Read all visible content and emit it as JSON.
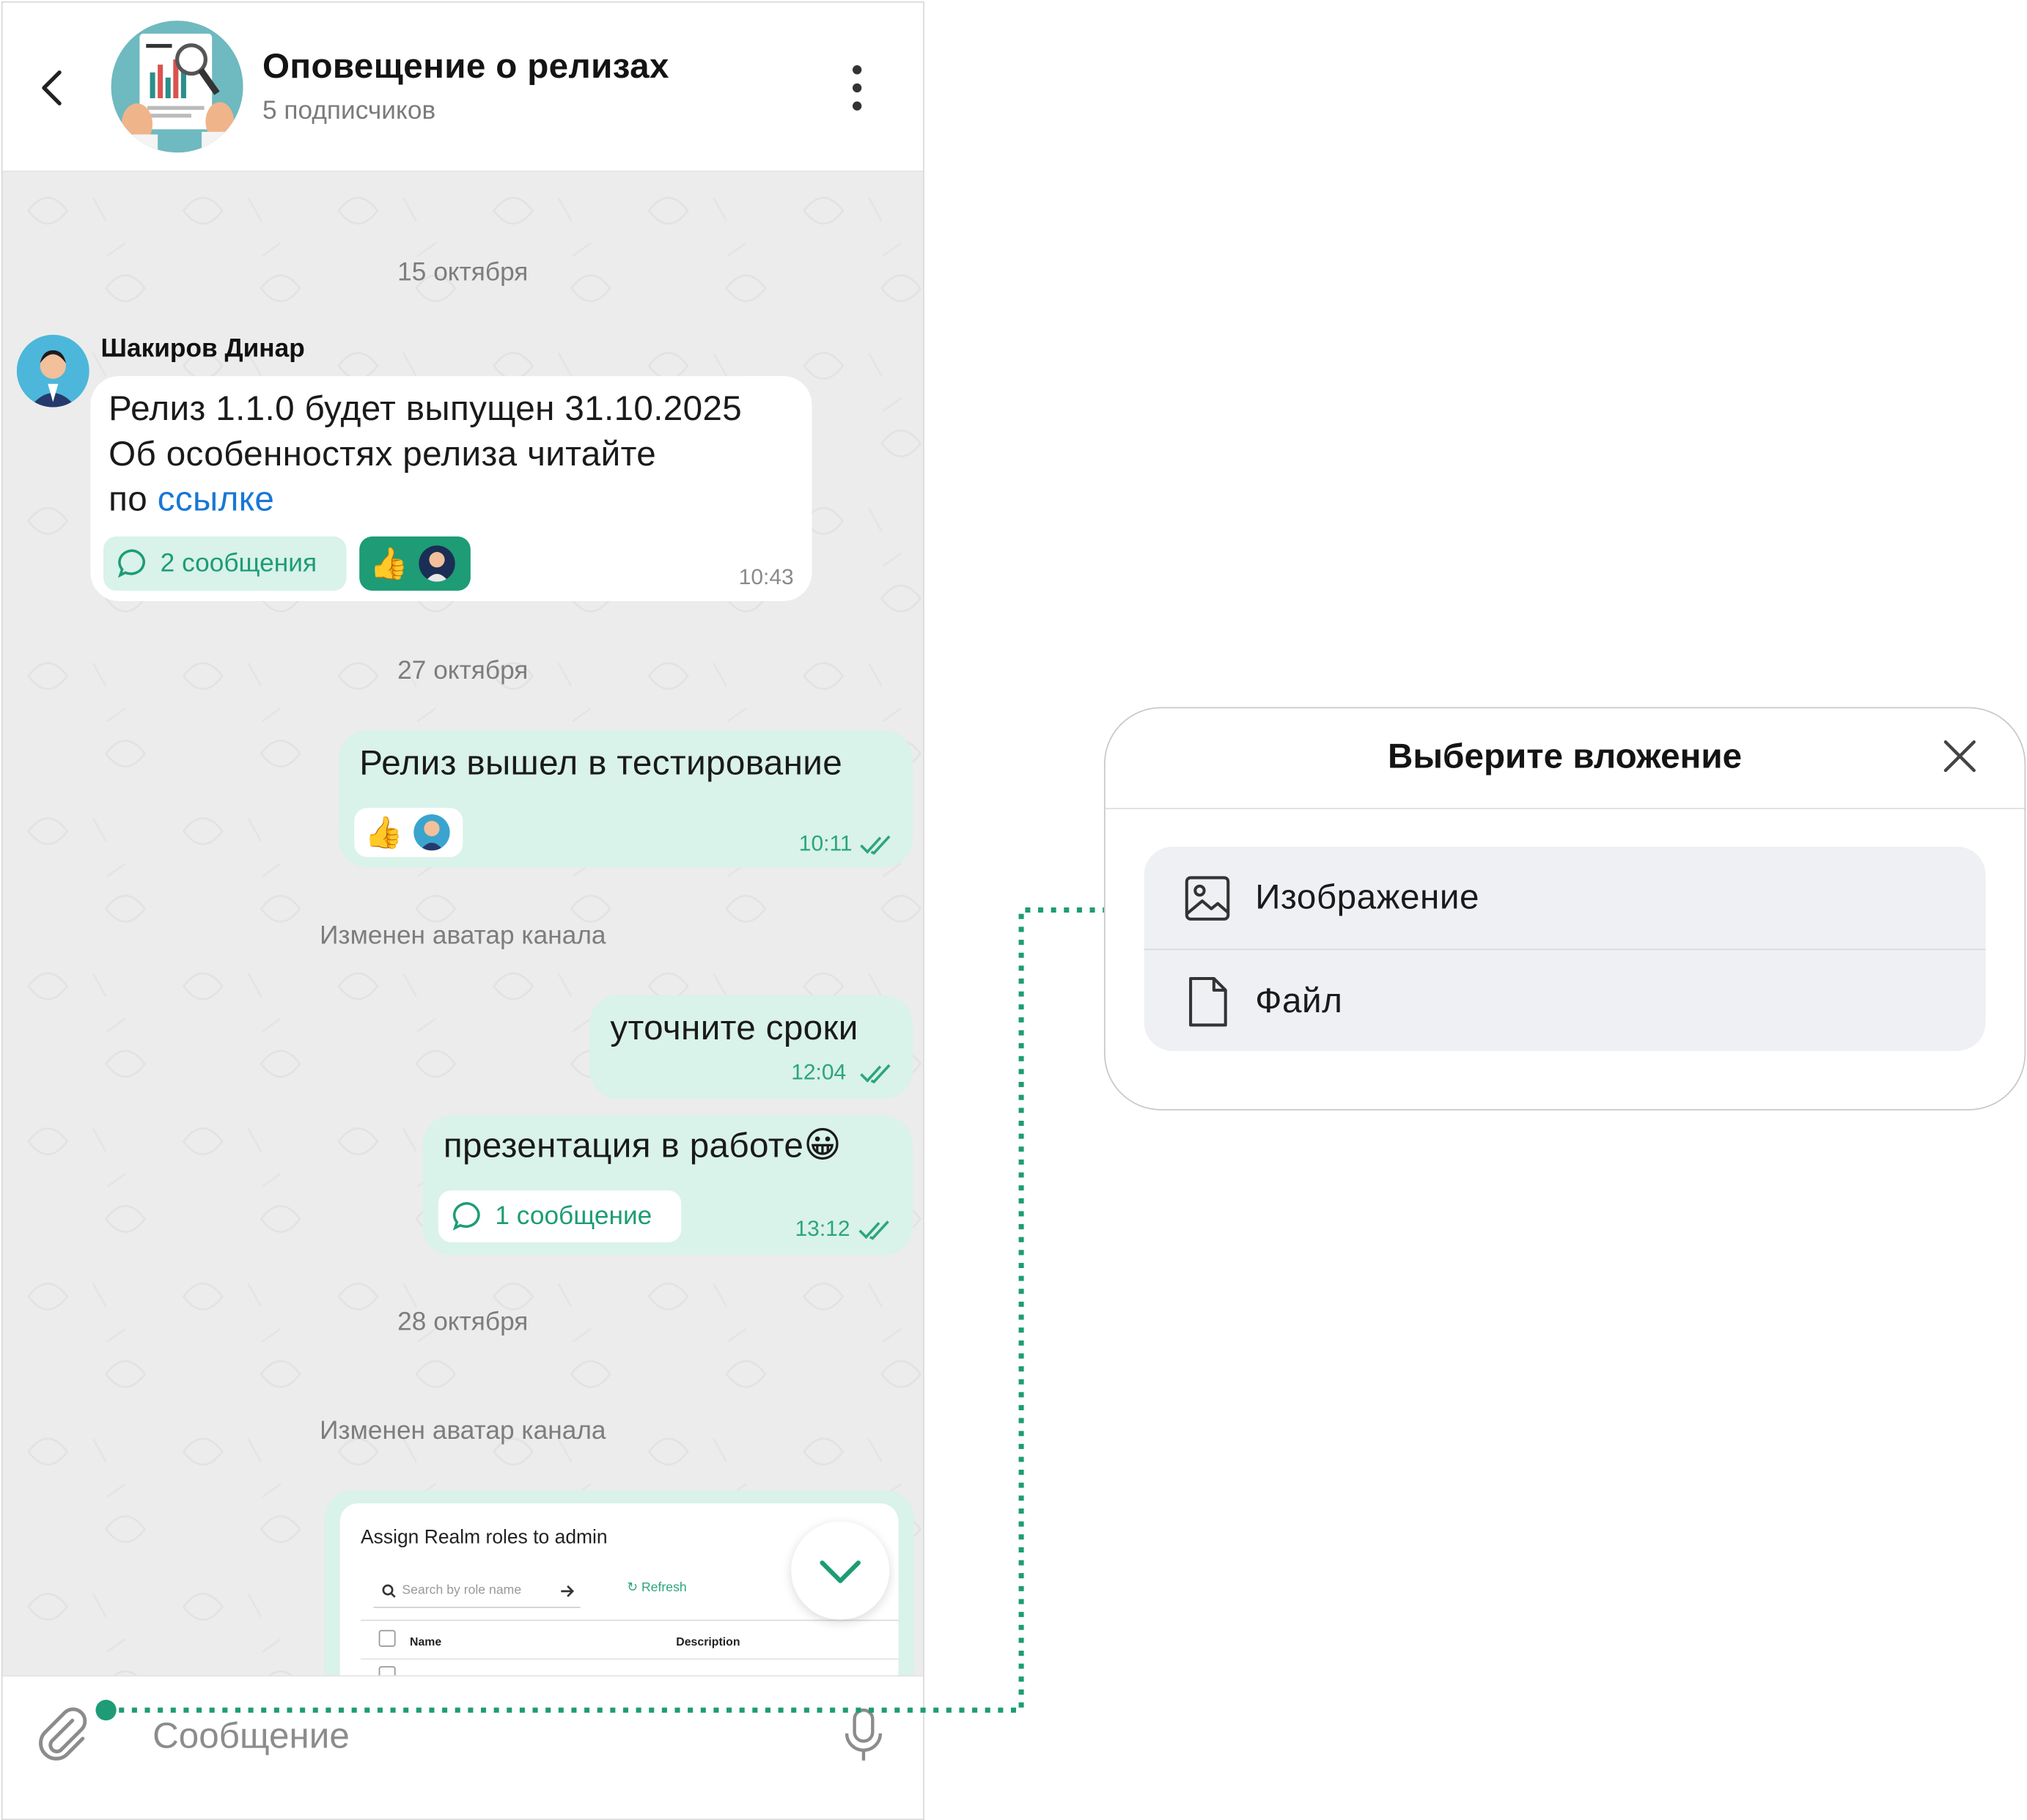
{
  "header": {
    "title": "Оповещение о релизах",
    "subtitle": "5 подписчиков"
  },
  "chat": {
    "dates": [
      "15 октября",
      "27 октября",
      "28 октября"
    ],
    "system_messages": [
      "Изменен аватар канала",
      "Изменен аватар канала"
    ],
    "message1": {
      "sender": "Шакиров Динар",
      "line1": "Релиз 1.1.0 будет выпущен 31.10.2025",
      "line2": "Об особенностях релиза читайте",
      "line3_prefix": "по ",
      "link": "ссылке",
      "thread": "2 сообщения",
      "reaction_emoji": "👍",
      "time": "10:43"
    },
    "message2": {
      "text": "Релиз вышел в тестирование",
      "reaction_emoji": "👍",
      "time": "10:11"
    },
    "message3": {
      "text": "уточните сроки",
      "time": "12:04"
    },
    "message4": {
      "text": "презентация в работе",
      "emoji": "😀",
      "thread": "1 сообщение",
      "time": "13:12"
    },
    "message5_screenshot": {
      "title": "Assign Realm roles to admin",
      "search_placeholder": "Search by role name",
      "refresh": "Refresh",
      "col_name": "Name",
      "col_description": "Description"
    }
  },
  "input": {
    "placeholder": "Сообщение"
  },
  "dialog": {
    "title": "Выберите вложение",
    "options": [
      {
        "label": "Изображение",
        "icon": "image-icon"
      },
      {
        "label": "Файл",
        "icon": "file-icon"
      }
    ]
  },
  "colors": {
    "accent": "#1d9c75",
    "connector": "#1d9c75",
    "outgoing_bubble": "#d9f2ea",
    "link": "#1877d6"
  }
}
